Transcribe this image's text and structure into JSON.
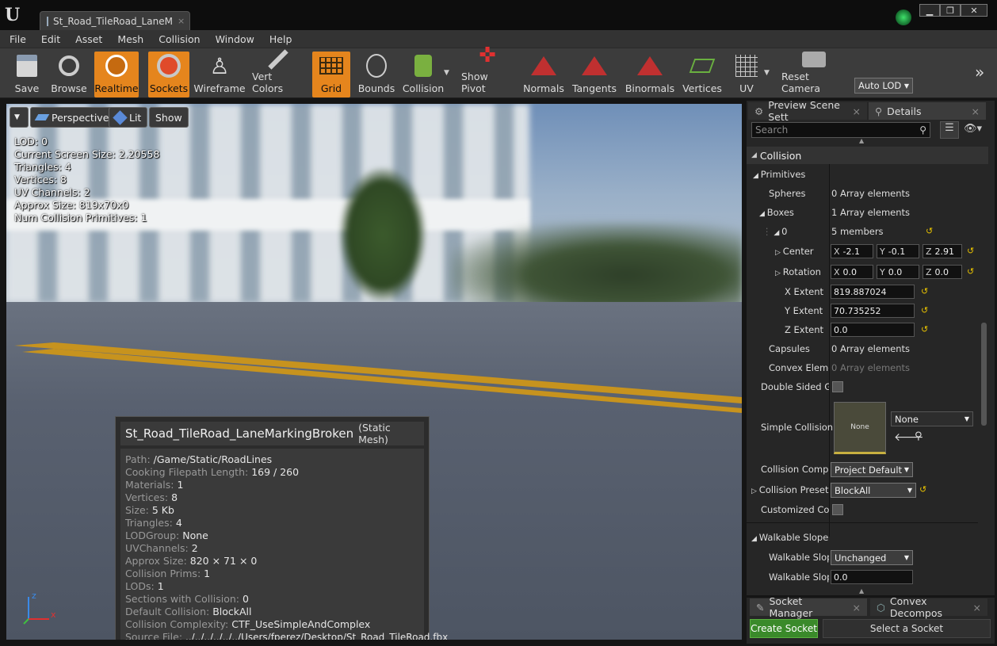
{
  "window": {
    "tab_title": "St_Road_TileRoad_LaneM",
    "tab_close": "×",
    "min": "▁",
    "max": "❐",
    "close": "✕"
  },
  "menu": [
    "File",
    "Edit",
    "Asset",
    "Mesh",
    "Collision",
    "Window",
    "Help"
  ],
  "toolbar": {
    "save": "Save",
    "browse": "Browse",
    "realtime": "Realtime",
    "sockets": "Sockets",
    "wireframe": "Wireframe",
    "vert_colors": "Vert Colors",
    "grid": "Grid",
    "bounds": "Bounds",
    "collision": "Collision",
    "show_pivot": "Show Pivot",
    "normals": "Normals",
    "tangents": "Tangents",
    "binormals": "Binormals",
    "vertices": "Vertices",
    "uv": "UV",
    "reset_camera": "Reset Camera",
    "auto_lod": "Auto LOD"
  },
  "viewport": {
    "perspective": "Perspective",
    "lit": "Lit",
    "show": "Show",
    "stats": [
      "LOD:  0",
      "Current Screen Size:  2.20558",
      "Triangles:  4",
      "Vertices:  8",
      "UV Channels:  2",
      "Approx Size: 819x70x0",
      "Num Collision Primitives:  1"
    ],
    "axis_z": "z",
    "axis_x": "x"
  },
  "tooltip": {
    "name": "St_Road_TileRoad_LaneMarkingBroken",
    "type": "(Static Mesh)",
    "rows": [
      {
        "k": "Path:",
        "v": "/Game/Static/RoadLines"
      },
      {
        "k": "Cooking Filepath Length:",
        "v": "169 / 260"
      },
      {
        "k": "Materials:",
        "v": "1"
      },
      {
        "k": "Vertices:",
        "v": "8"
      },
      {
        "k": "Size:",
        "v": "5 Kb"
      },
      {
        "k": "Triangles:",
        "v": "4"
      },
      {
        "k": "LODGroup:",
        "v": "None"
      },
      {
        "k": "UVChannels:",
        "v": "2"
      },
      {
        "k": "Approx Size:",
        "v": "820 × 71 × 0"
      },
      {
        "k": "Collision Prims:",
        "v": "1"
      },
      {
        "k": "LODs:",
        "v": "1"
      },
      {
        "k": "Sections with Collision:",
        "v": "0"
      },
      {
        "k": "Default Collision:",
        "v": "BlockAll"
      },
      {
        "k": "Collision Complexity:",
        "v": "CTF_UseSimpleAndComplex"
      },
      {
        "k": "Source File:",
        "v": "../../../../../../Users/fperez/Desktop/St_Road_TileRoad.fbx"
      }
    ]
  },
  "panel": {
    "tab1": "Preview Scene Sett",
    "tab2": "Details",
    "search_placeholder": "Search",
    "section_collision": "Collision",
    "primitives": "Primitives",
    "spheres": "Spheres",
    "spheres_val": "0 Array elements",
    "boxes": "Boxes",
    "boxes_val": "1 Array elements",
    "box0": "0",
    "box0_val": "5 members",
    "center": "Center",
    "center_x": "-2.1",
    "center_y": "-0.1",
    "center_z": "2.91",
    "rotation": "Rotation",
    "rot_x": "0.0",
    "rot_y": "0.0",
    "rot_z": "0.0",
    "x_extent": "X Extent",
    "x_extent_val": "819.887024",
    "y_extent": "Y Extent",
    "y_extent_val": "70.735252",
    "z_extent": "Z Extent",
    "z_extent_val": "0.0",
    "capsules": "Capsules",
    "capsules_val": "0 Array elements",
    "convex": "Convex Elemer",
    "convex_val": "0 Array elements",
    "double_sided": "Double Sided Gec",
    "simple_collision": "Simple Collision",
    "thumb_label": "None",
    "simple_collision_combo": "None",
    "collision_complexity": "Collision Comple",
    "collision_complexity_val": "Project Default",
    "collision_presets": "Collision Presets",
    "collision_presets_val": "BlockAll",
    "customized": "Customized Colli",
    "walkable_section": "Walkable Slope C",
    "walkable1": "Walkable Slope",
    "walkable1_val": "Unchanged",
    "walkable2": "Walkable Slope",
    "walkable2_val": "0.0",
    "lbl_x": "X",
    "lbl_y": "Y",
    "lbl_z": "Z"
  },
  "bottom": {
    "tab1": "Socket Manager",
    "tab2": "Convex Decompos",
    "create_socket": "Create Socket",
    "select_socket": "Select a Socket"
  }
}
